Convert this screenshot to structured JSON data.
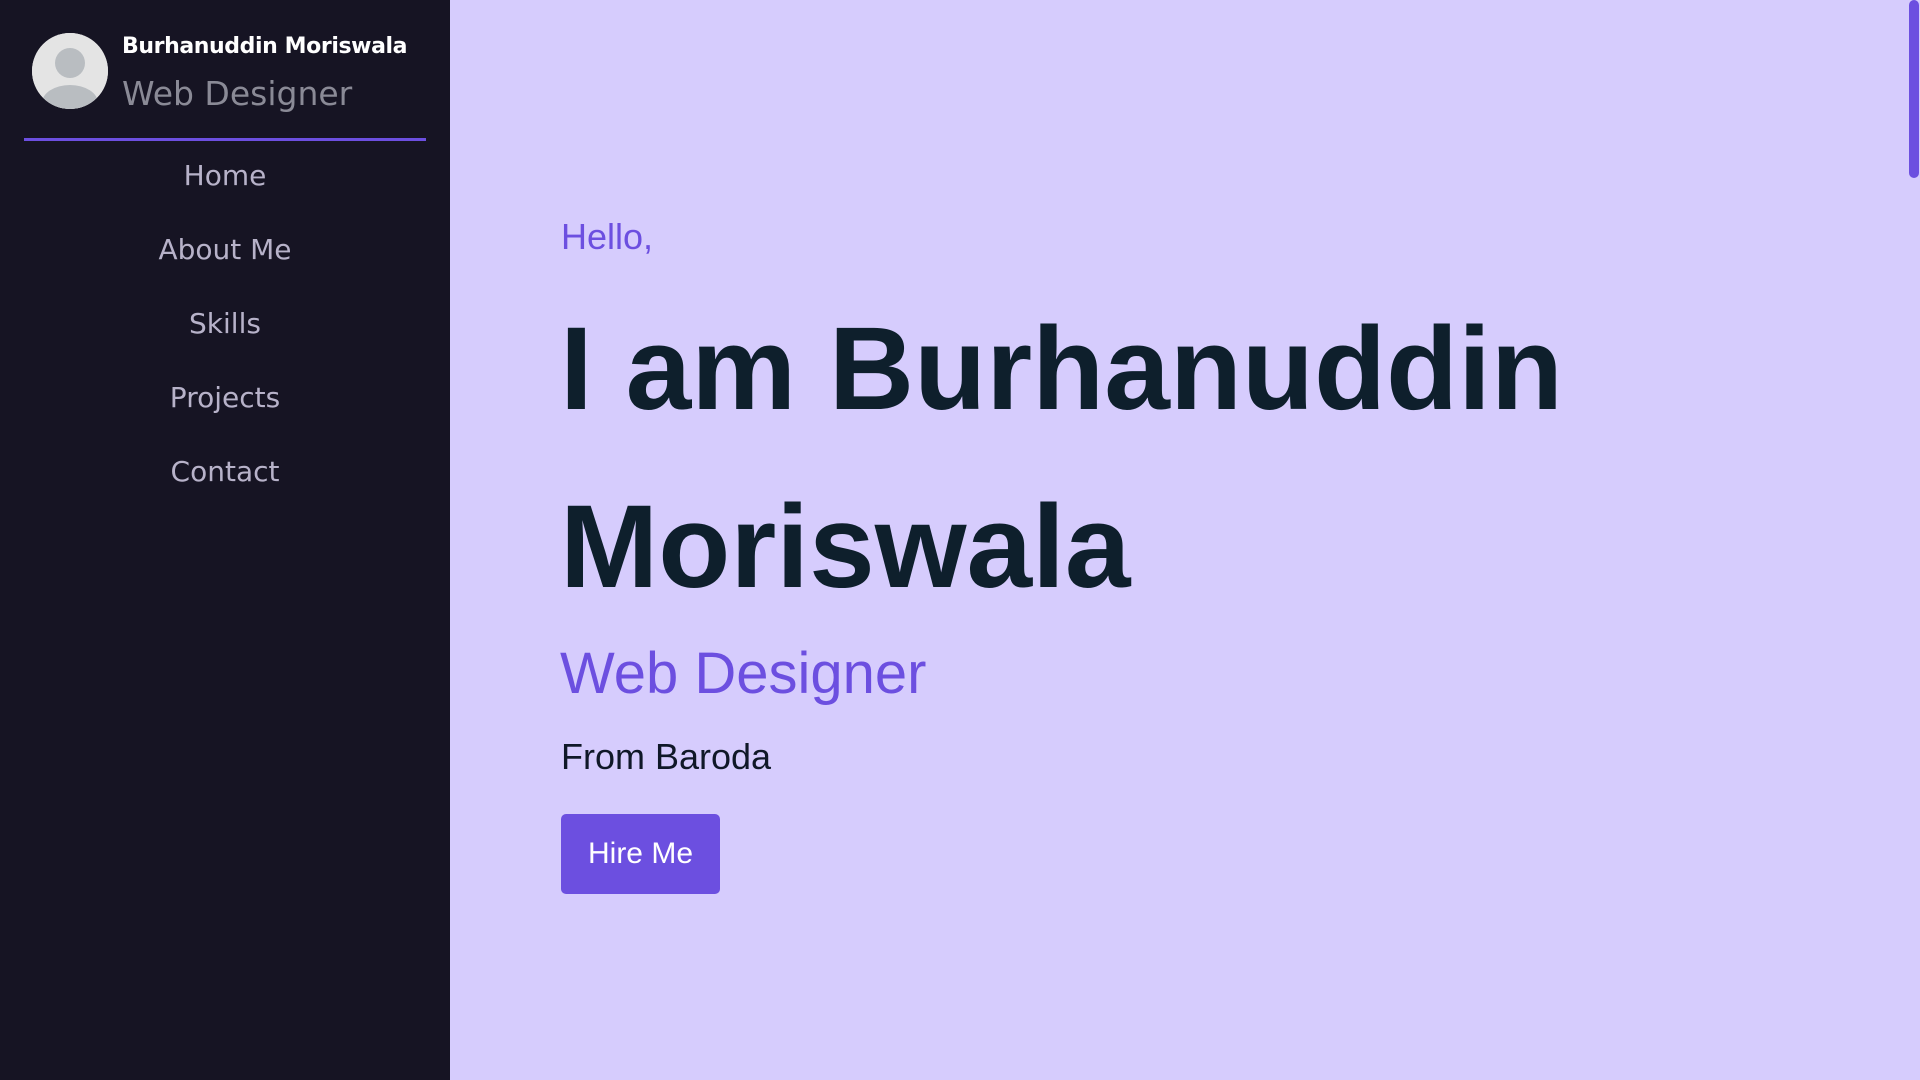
{
  "sidebar": {
    "profile": {
      "name": "Burhanuddin Moriswala",
      "role": "Web Designer",
      "avatar_icon": "user-avatar-icon"
    },
    "nav": [
      {
        "label": "Home"
      },
      {
        "label": "About Me"
      },
      {
        "label": "Skills"
      },
      {
        "label": "Projects"
      },
      {
        "label": "Contact"
      }
    ]
  },
  "hero": {
    "greeting": "Hello,",
    "headline_line1": "I am Burhanuddin",
    "headline_line2": "Moriswala",
    "role": "Web Designer",
    "location": "From Baroda",
    "cta_label": "Hire Me"
  },
  "colors": {
    "accent": "#6c4fe0",
    "sidebar_bg": "#161423",
    "page_bg": "#d6ccfd",
    "heading": "#0e1f2c"
  }
}
